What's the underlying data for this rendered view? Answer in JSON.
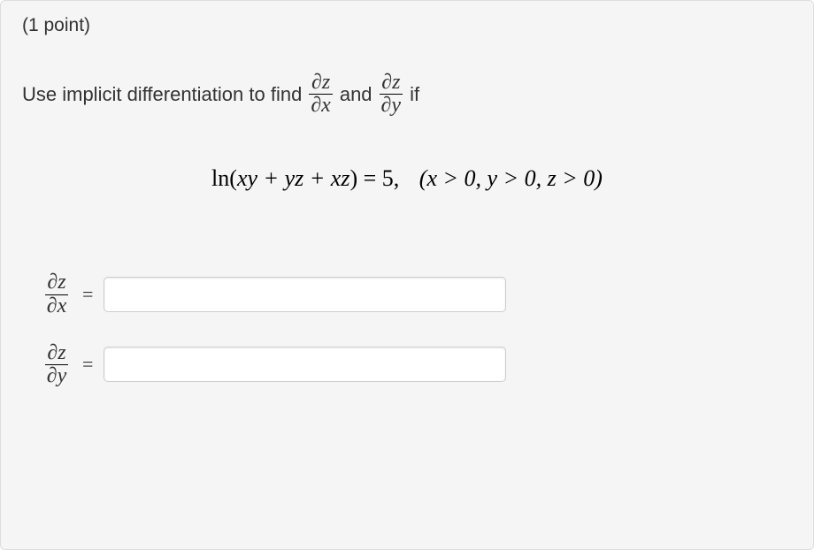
{
  "points_label": "(1 point)",
  "prompt": {
    "pre": "Use implicit differentiation to find",
    "frac1": {
      "num": "∂z",
      "den": "∂x"
    },
    "mid": "and",
    "frac2": {
      "num": "∂z",
      "den": "∂y"
    },
    "post": "if"
  },
  "equation": {
    "lhs_fn": "ln",
    "lhs_arg": "xy + yz + xz",
    "rhs": "5",
    "cond": "(x > 0,  y > 0,  z > 0)"
  },
  "answers": {
    "row1": {
      "num": "∂z",
      "den": "∂x",
      "eq": "=",
      "value": "",
      "placeholder": ""
    },
    "row2": {
      "num": "∂z",
      "den": "∂y",
      "eq": "=",
      "value": "",
      "placeholder": ""
    }
  }
}
